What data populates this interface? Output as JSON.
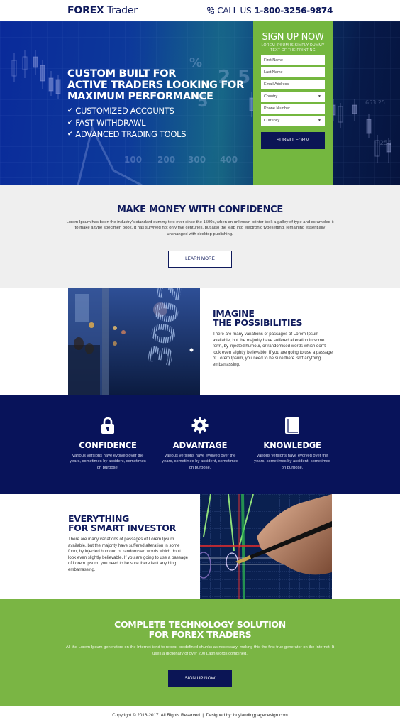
{
  "header": {
    "logo_bold": "FOREX",
    "logo_light": "Trader",
    "call_label": "CALL US",
    "phone": "1-800-3256-9874",
    "phone_icon": "phone-icon"
  },
  "hero": {
    "title_lines": [
      "CUSTOM BUILT FOR",
      "ACTIVE TRADERS LOOKING FOR",
      "MAXIMUM PERFORMANCE"
    ],
    "bullets": [
      "CUSTOMIZED ACCOUNTS",
      "FAST WITHDRAWL",
      "ADVANCED TRADING TOOLS"
    ],
    "bullet_icon": "check-icon",
    "background_labels": [
      "%",
      "2.5",
      "100",
      "200",
      "300",
      "400",
      "653.25",
      "+255",
      ".25"
    ]
  },
  "signup_form": {
    "title": "SIGN UP NOW",
    "subtitle_lines": [
      "LOREM IPSUM IS SIMPLY DUMMY",
      "TEXT OF THE PRINTING"
    ],
    "fields": [
      {
        "placeholder": "First Name",
        "type": "text"
      },
      {
        "placeholder": "Last Name",
        "type": "text"
      },
      {
        "placeholder": "Email Address",
        "type": "text"
      },
      {
        "placeholder": "Country",
        "type": "select"
      },
      {
        "placeholder": "Phone Number",
        "type": "text"
      },
      {
        "placeholder": "Currency",
        "type": "select"
      }
    ],
    "submit_label": "SUBMIT FORM"
  },
  "money": {
    "title": "MAKE MONEY WITH CONFIDENCE",
    "text": "Lorem Ipsum has been the industry's standard dummy text ever since the 1500s, when an unknown printer took a galley of type and scrambled it to make a type specimen book. It has survived not only five centuries, but also the leap into electronic typesetting, remaining essentially unchanged with desktop publishing.",
    "button_label": "LEARN MORE"
  },
  "imagine": {
    "title_lines": [
      "IMAGINE",
      "THE POSSIBILITIES"
    ],
    "text": "There are many variations of passages of Lorem Ipsum available, but the majority have suffered alteration in some form, by injected humour, or randomised words which don't look even slightly believable. If you are going to use a passage of Lorem Ipsum, you need to be sure there isn't anything embarrassing.",
    "image_label": "stock-ticker-image"
  },
  "features": [
    {
      "icon": "lock-icon",
      "title": "CONFIDENCE",
      "text": "Various versions have evolved over the years, sometimes by accident, sometimes on purpose."
    },
    {
      "icon": "gear-icon",
      "title": "ADVANTAGE",
      "text": "Various versions have evolved over the years, sometimes by accident, sometimes on purpose."
    },
    {
      "icon": "book-icon",
      "title": "KNOWLEDGE",
      "text": "Various versions have evolved over the years, sometimes by accident, sometimes on purpose."
    }
  ],
  "everything": {
    "title_lines": [
      "EVERYTHING",
      "FOR SMART INVESTOR"
    ],
    "text": "There are many variations of passages of Lorem Ipsum available, but the majority have suffered alteration in some form, by injected humour, or randomised words which don't look even slightly believable. If you are going to use a passage of Lorem Ipsum, you need to be sure there isn't anything embarrassing.",
    "image_label": "pen-chart-image"
  },
  "cta": {
    "title_lines": [
      "COMPLETE TECHNOLOGY SOLUTION",
      "FOR FOREX TRADERS"
    ],
    "text": "All the Lorem Ipsum generators on the Internet tend to repeat predefined chunks as necessary, making this the first true generator on the Internet. It uses a dictionary of over 200 Latin words combined.",
    "button_label": "SIGN UP NOW"
  },
  "footer": {
    "copyright": "Copyright © 2016-2017. All Rights Reserved",
    "separator": "|",
    "designed_by": "Designed by: buylandingpagedesign.com"
  },
  "colors": {
    "navy": "#0f1a5c",
    "dark_navy": "#08135a",
    "green": "#74b73f",
    "light_gray": "#efefef"
  }
}
